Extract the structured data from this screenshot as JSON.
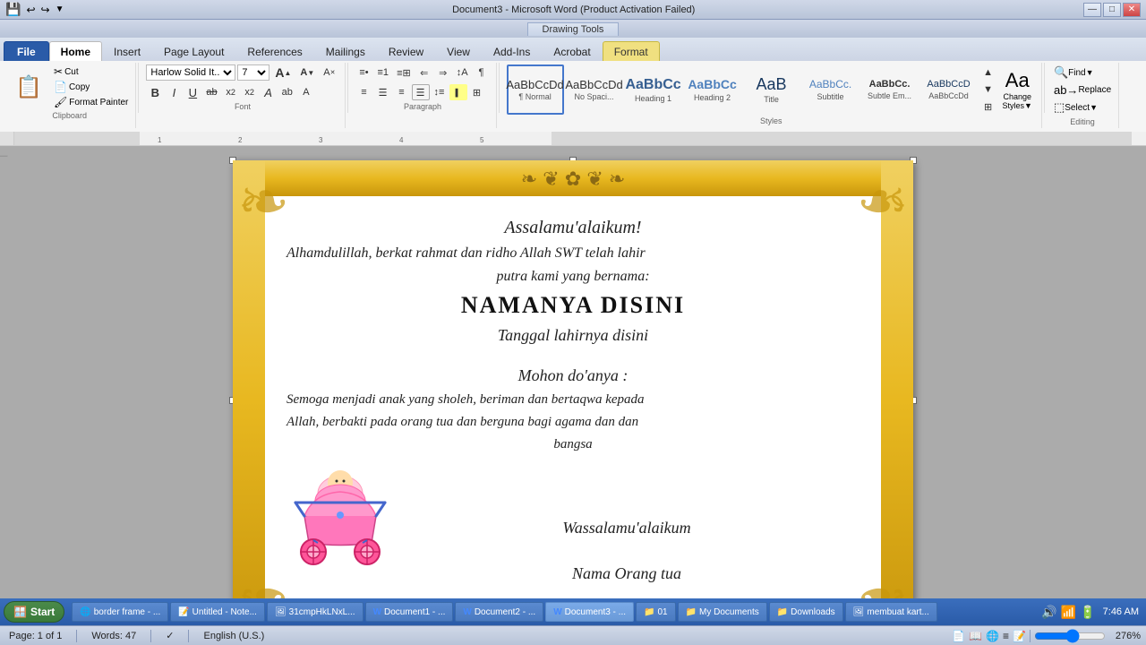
{
  "titlebar": {
    "title": "Document3 - Microsoft Word (Product Activation Failed)",
    "drawing_tools": "Drawing Tools",
    "controls": [
      "—",
      "□",
      "✕"
    ]
  },
  "tabs": {
    "file": "File",
    "home": "Home",
    "insert": "Insert",
    "page_layout": "Page Layout",
    "references": "References",
    "mailings": "Mailings",
    "review": "Review",
    "view": "View",
    "add_ins": "Add-Ins",
    "acrobat": "Acrobat",
    "format": "Format"
  },
  "clipboard": {
    "label": "Clipboard",
    "paste": "Paste",
    "cut": "Cut",
    "copy": "Copy",
    "format_painter": "Format Painter"
  },
  "font": {
    "label": "Font",
    "name": "Harlow Solid It...",
    "size": "7",
    "grow": "A",
    "shrink": "A",
    "clear": "A",
    "bold": "B",
    "italic": "I",
    "underline": "U",
    "strikethrough": "ab",
    "subscript": "x₂",
    "superscript": "x²",
    "text_highlight": "ab",
    "font_color": "A"
  },
  "paragraph": {
    "label": "Paragraph",
    "bullets": "≡",
    "numbering": "≡",
    "multilevel": "≡",
    "decrease_indent": "⇐",
    "increase_indent": "⇒",
    "sort": "↕A",
    "show_marks": "¶",
    "align_left": "≡",
    "center": "≡",
    "align_right": "≡",
    "justify": "≡",
    "line_spacing": "↕",
    "shading": "■",
    "borders": "□"
  },
  "styles": {
    "label": "Styles",
    "items": [
      {
        "id": "normal",
        "preview": "AaBbCcDd",
        "label": "¶ Normal",
        "active": true
      },
      {
        "id": "no-space",
        "preview": "AaBbCcDd",
        "label": "No Spaci...",
        "active": false
      },
      {
        "id": "heading1",
        "preview": "AaBbCc",
        "label": "Heading 1",
        "active": false
      },
      {
        "id": "heading2",
        "preview": "AaBbCc",
        "label": "Heading 2",
        "active": false
      },
      {
        "id": "title",
        "preview": "AaB",
        "label": "Title",
        "active": false
      },
      {
        "id": "subtitle",
        "preview": "AaBbCc.",
        "label": "Subtitle",
        "active": false
      },
      {
        "id": "subtle-em",
        "preview": "AaBbCc.",
        "label": "Subtle Em...",
        "active": false
      },
      {
        "id": "accd",
        "preview": "AaBbCcD",
        "label": "AaBbCcDd",
        "active": false
      }
    ],
    "change_styles": "Change\nStyles"
  },
  "editing": {
    "label": "Editing",
    "find": "Find",
    "replace": "Replace",
    "select": "Select"
  },
  "document": {
    "greeting": "Assalamu'alaikum!",
    "line1": "Alhamdulillah, berkat rahmat dan ridho Allah SWT telah lahir",
    "line2": "putra kami yang bernama:",
    "name": "NAMANYA DISINI",
    "date": "Tanggal lahirnya disini",
    "request": "Mohon do'anya :",
    "pray1": "Semoga menjadi anak yang sholeh, beriman dan bertaqwa kepada",
    "pray2": "Allah, berbakti pada orang tua dan berguna bagi agama dan dan",
    "pray3": "bangsa",
    "closing": "Wassalamu'alaikum",
    "parent": "Nama Orang tua"
  },
  "statusbar": {
    "page": "Page: 1 of 1",
    "words": "Words: 47",
    "language": "English (U.S.)",
    "zoom": "276%"
  },
  "taskbar": {
    "start": "Start",
    "items": [
      {
        "label": "border frame - ...",
        "icon": "🌐",
        "active": false
      },
      {
        "label": "Untitled - Note...",
        "icon": "📝",
        "active": false
      },
      {
        "label": "31cmpHkLNxL....",
        "icon": "🖼",
        "active": false
      },
      {
        "label": "Document1 - ...",
        "icon": "W",
        "active": false
      },
      {
        "label": "Document2 - ...",
        "icon": "W",
        "active": false
      },
      {
        "label": "Document3 - ...",
        "icon": "W",
        "active": true
      },
      {
        "label": "01",
        "icon": "📁",
        "active": false
      },
      {
        "label": "My Documents",
        "icon": "📁",
        "active": false
      },
      {
        "label": "Downloads",
        "icon": "📁",
        "active": false
      },
      {
        "label": "membuat kart...",
        "icon": "🖼",
        "active": false
      }
    ],
    "clock": "7:46 AM"
  }
}
